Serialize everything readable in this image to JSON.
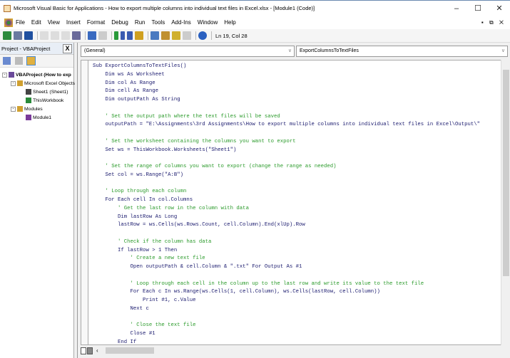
{
  "window": {
    "title": "Microsoft Visual Basic for Applications - How to export multiple columns into individual text files in Excel.xlsx - [Module1 (Code)]",
    "minimize": "–",
    "maximize": "☐",
    "close": "✕"
  },
  "menu": [
    "File",
    "Edit",
    "View",
    "Insert",
    "Format",
    "Debug",
    "Run",
    "Tools",
    "Add-Ins",
    "Window",
    "Help"
  ],
  "mdi_controls": "▪ ⧉ ✕",
  "toolbar": {
    "status": "Ln 19, Col 28"
  },
  "project": {
    "title": "Project - VBAProject",
    "close": "X",
    "tree": [
      {
        "label": "VBAProject (How to exp",
        "level": 0,
        "toggle": "-"
      },
      {
        "label": "Microsoft Excel Objects",
        "level": 1,
        "toggle": "-"
      },
      {
        "label": "Sheet1 (Sheet1)",
        "level": 2,
        "toggle": ""
      },
      {
        "label": "ThisWorkbook",
        "level": 2,
        "toggle": ""
      },
      {
        "label": "Modules",
        "level": 1,
        "toggle": "-"
      },
      {
        "label": "Module1",
        "level": 2,
        "toggle": ""
      }
    ]
  },
  "code": {
    "object_combo": "(General)",
    "proc_combo": "ExportColumnsToTextFiles",
    "lines": [
      {
        "t": "Sub ExportColumnsToTextFiles()",
        "k": "code"
      },
      {
        "t": "    Dim ws As Worksheet",
        "k": "code"
      },
      {
        "t": "    Dim col As Range",
        "k": "code"
      },
      {
        "t": "    Dim cell As Range",
        "k": "code"
      },
      {
        "t": "    Dim outputPath As String",
        "k": "code"
      },
      {
        "t": "",
        "k": "code"
      },
      {
        "t": "    ' Set the output path where the text files will be saved",
        "k": "comment"
      },
      {
        "t": "    outputPath = \"E:\\Assignments\\3rd Assignments\\How to export multiple columns into individual text files in Excel\\Output\\\"",
        "k": "code"
      },
      {
        "t": "",
        "k": "code"
      },
      {
        "t": "    ' Set the worksheet containing the columns you want to export",
        "k": "comment"
      },
      {
        "t": "    Set ws = ThisWorkbook.Worksheets(\"Sheet1\")",
        "k": "code"
      },
      {
        "t": "",
        "k": "code"
      },
      {
        "t": "    ' Set the range of columns you want to export (change the range as needed)",
        "k": "comment"
      },
      {
        "t": "    Set col = ws.Range(\"A:B\")",
        "k": "code"
      },
      {
        "t": "",
        "k": "code"
      },
      {
        "t": "    ' Loop through each column",
        "k": "comment"
      },
      {
        "t": "    For Each cell In col.Columns",
        "k": "code"
      },
      {
        "t": "        ' Get the last row in the column with data",
        "k": "comment"
      },
      {
        "t": "        Dim lastRow As Long",
        "k": "code"
      },
      {
        "t": "        lastRow = ws.Cells(ws.Rows.Count, cell.Column).End(xlUp).Row",
        "k": "code"
      },
      {
        "t": "",
        "k": "code"
      },
      {
        "t": "        ' Check if the column has data",
        "k": "comment"
      },
      {
        "t": "        If lastRow > 1 Then",
        "k": "code"
      },
      {
        "t": "            ' Create a new text file",
        "k": "comment"
      },
      {
        "t": "            Open outputPath & cell.Column & \".txt\" For Output As #1",
        "k": "code"
      },
      {
        "t": "",
        "k": "code"
      },
      {
        "t": "            ' Loop through each cell in the column up to the last row and write its value to the text file",
        "k": "comment"
      },
      {
        "t": "            For Each c In ws.Range(ws.Cells(1, cell.Column), ws.Cells(lastRow, cell.Column))",
        "k": "code"
      },
      {
        "t": "                Print #1, c.Value",
        "k": "code"
      },
      {
        "t": "            Next c",
        "k": "code"
      },
      {
        "t": "",
        "k": "code"
      },
      {
        "t": "            ' Close the text file",
        "k": "comment"
      },
      {
        "t": "            Close #1",
        "k": "code"
      },
      {
        "t": "        End If",
        "k": "code"
      }
    ]
  }
}
